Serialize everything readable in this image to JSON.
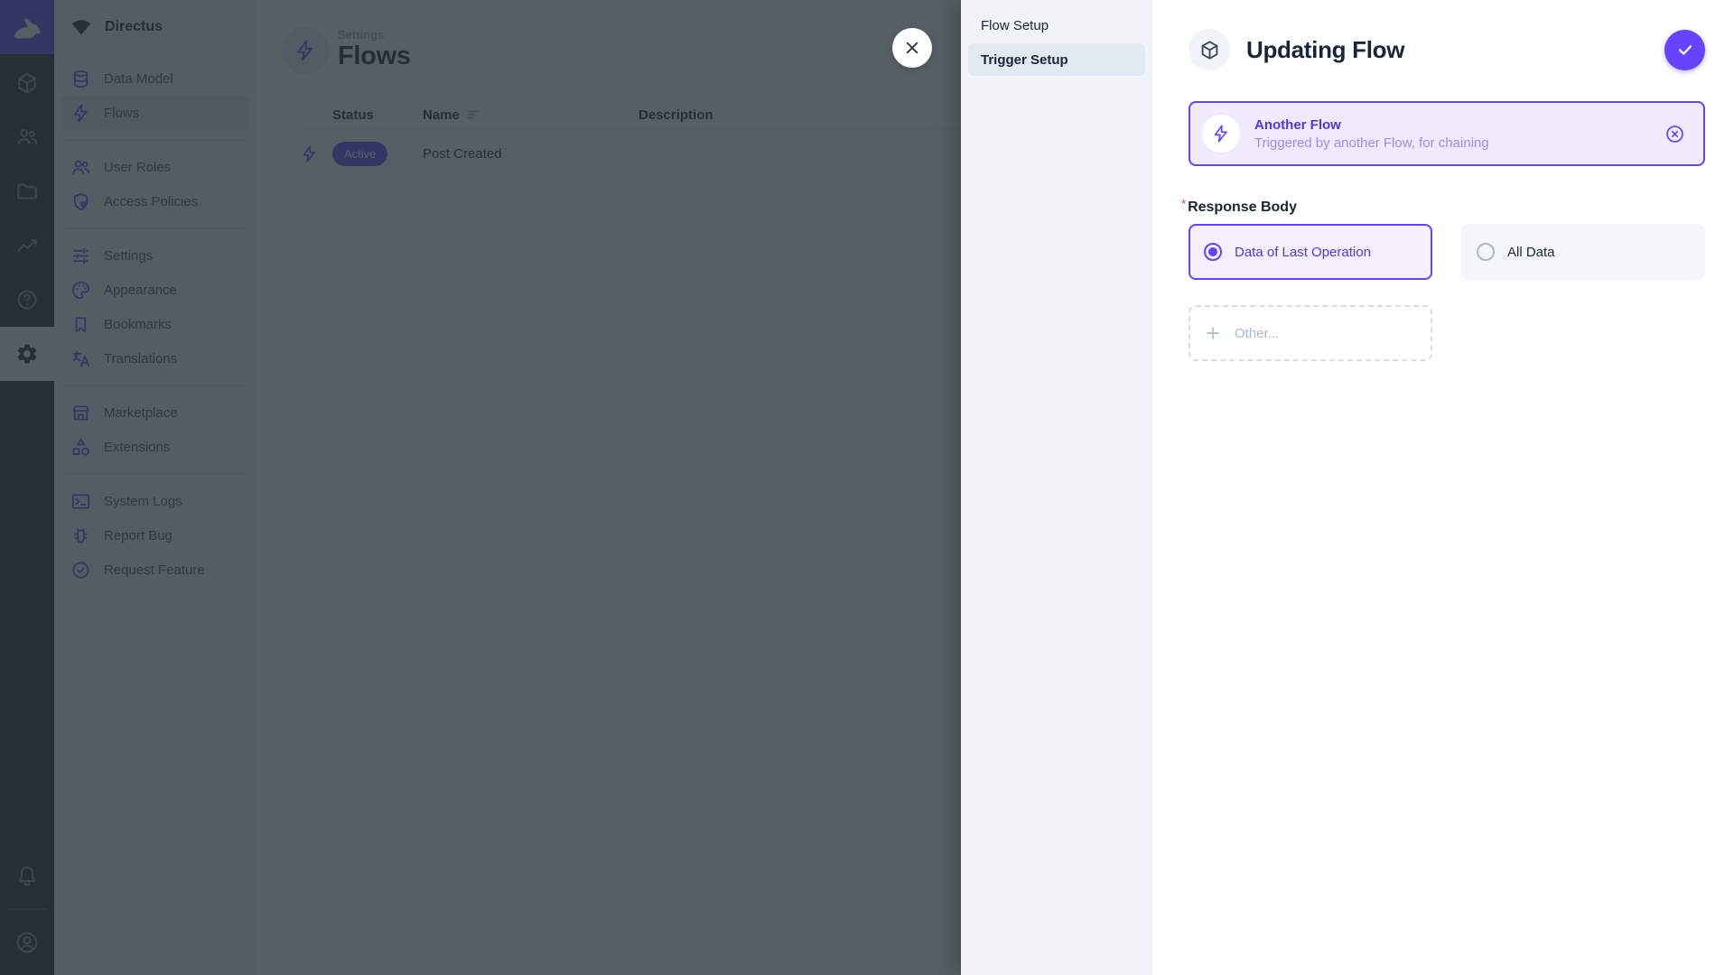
{
  "colors": {
    "primary": "#6644FF",
    "overlay": "rgba(38,50,56,0.78)"
  },
  "module_bar": {
    "modules": [
      {
        "name": "content",
        "icon": "box-icon",
        "active": false
      },
      {
        "name": "users",
        "icon": "people-icon",
        "active": false
      },
      {
        "name": "files",
        "icon": "folder-icon",
        "active": false
      },
      {
        "name": "insights",
        "icon": "insights-icon",
        "active": false
      },
      {
        "name": "help",
        "icon": "help-icon",
        "active": false
      },
      {
        "name": "settings",
        "icon": "gear-icon",
        "active": true
      }
    ]
  },
  "nav": {
    "project_name": "Directus",
    "items": [
      {
        "label": "Data Model",
        "icon": "database-icon",
        "active": false
      },
      {
        "label": "Flows",
        "icon": "bolt-icon",
        "active": true
      },
      {
        "label": "User Roles",
        "icon": "people-icon",
        "active": false
      },
      {
        "label": "Access Policies",
        "icon": "shield-lock-icon",
        "active": false
      },
      {
        "label": "Settings",
        "icon": "tune-icon",
        "active": false
      },
      {
        "label": "Appearance",
        "icon": "palette-icon",
        "active": false
      },
      {
        "label": "Bookmarks",
        "icon": "bookmark-icon",
        "active": false
      },
      {
        "label": "Translations",
        "icon": "translate-icon",
        "active": false
      },
      {
        "label": "Marketplace",
        "icon": "storefront-icon",
        "active": false
      },
      {
        "label": "Extensions",
        "icon": "category-icon",
        "active": false
      },
      {
        "label": "System Logs",
        "icon": "terminal-icon",
        "active": false
      },
      {
        "label": "Report Bug",
        "icon": "bug-icon",
        "active": false
      },
      {
        "label": "Request Feature",
        "icon": "feature-check-icon",
        "active": false
      }
    ]
  },
  "page": {
    "breadcrumb": "Settings",
    "title": "Flows",
    "table": {
      "columns": [
        "Status",
        "Name",
        "Description"
      ],
      "rows": [
        {
          "status": "Active",
          "name": "Post Created",
          "description": ""
        }
      ]
    }
  },
  "drawer": {
    "sections": [
      {
        "label": "Flow Setup",
        "active": false
      },
      {
        "label": "Trigger Setup",
        "active": true
      }
    ],
    "title": "Updating Flow",
    "trigger_card": {
      "title": "Another Flow",
      "subtitle": "Triggered by another Flow, for chaining"
    },
    "response_body": {
      "label": "Response Body",
      "required": "*",
      "options": [
        {
          "label": "Data of Last Operation",
          "selected": true
        },
        {
          "label": "All Data",
          "selected": false
        }
      ],
      "other_label": "Other..."
    }
  }
}
